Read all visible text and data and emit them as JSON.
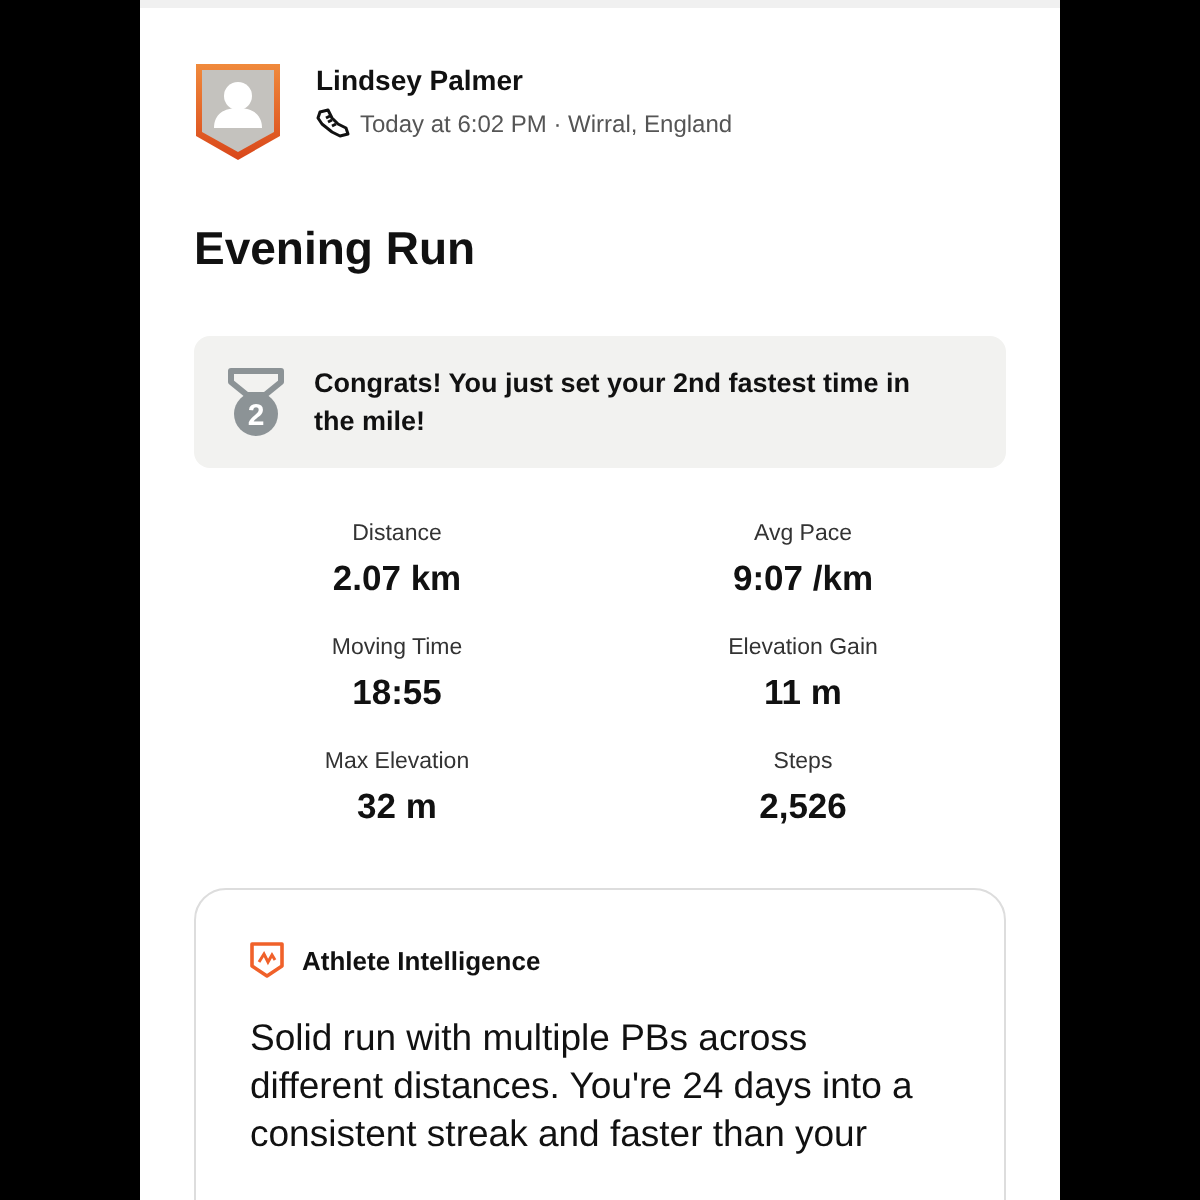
{
  "athlete": {
    "name": "Lindsey Palmer",
    "meta": "Today at 6:02 PM · Wirral, England"
  },
  "activity": {
    "title": "Evening Run"
  },
  "achievement": {
    "rank": "2",
    "message": "Congrats! You just set your 2nd fastest time in the mile!"
  },
  "stats": [
    {
      "label": "Distance",
      "value": "2.07 km"
    },
    {
      "label": "Avg Pace",
      "value": "9:07 /km"
    },
    {
      "label": "Moving Time",
      "value": "18:55"
    },
    {
      "label": "Elevation Gain",
      "value": "11 m"
    },
    {
      "label": "Max Elevation",
      "value": "32 m"
    },
    {
      "label": "Steps",
      "value": "2,526"
    }
  ],
  "insight": {
    "title": "Athlete Intelligence",
    "summary": "Solid run with multiple PBs across different distances. You're 24 days into a consistent streak and faster than your"
  }
}
